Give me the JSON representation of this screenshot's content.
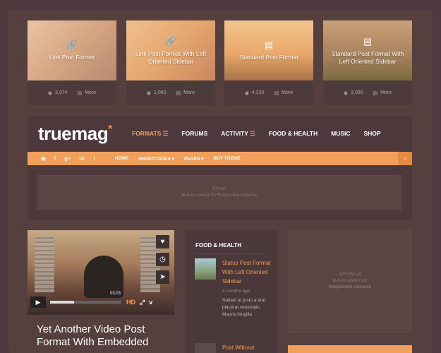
{
  "featured": [
    {
      "title": "Link Post Format",
      "views": "3,974",
      "more": "More",
      "icon": "link-icon"
    },
    {
      "title": "Link Post Format With Left Oriented Sidebar",
      "views": "1,080",
      "more": "More",
      "icon": "link-icon"
    },
    {
      "title": "Standard Post Format",
      "views": "4,230",
      "more": "More",
      "icon": "document-icon"
    },
    {
      "title": "Standard Post Format With Left Oriented Sidebar",
      "views": "3,096",
      "more": "More",
      "icon": "document-icon"
    }
  ],
  "logo": {
    "text": "truemag",
    "star": "*"
  },
  "nav": {
    "formats": "FORMATS",
    "forums": "FORUMS",
    "activity": "ACTIVITY",
    "food": "FOOD & HEALTH",
    "music": "MUSIC",
    "shop": "SHOP"
  },
  "subnav": {
    "home": "HOME",
    "shortcodes": "SHORTCODES",
    "pages": "PAGES",
    "buy": "BUY THEME"
  },
  "ad_top": {
    "line1": "970x90",
    "line2": "built-in solution for Responsive Adsense"
  },
  "video": {
    "time": "03:03",
    "hd": "HD",
    "progress": 0.34
  },
  "post": {
    "title": "Yet Another Video Post Format With Embedded"
  },
  "widget": {
    "title": "FOOD & HEALTH",
    "items": [
      {
        "title": "Status Post Format With Left Oriented Sidebar",
        "date": "4 months ago",
        "excerpt": "Nullam at justo a erat placerat venenatis. Mauris fringilla."
      },
      {
        "title": "Post Without"
      }
    ]
  },
  "ad_right": {
    "line1": "300x250 ad",
    "line2": "built-in solution for",
    "line3": "Responsive Adsense"
  },
  "colors": {
    "accent": "#f0a05a",
    "bg": "#4f3a3f",
    "link": "#f29a55"
  }
}
